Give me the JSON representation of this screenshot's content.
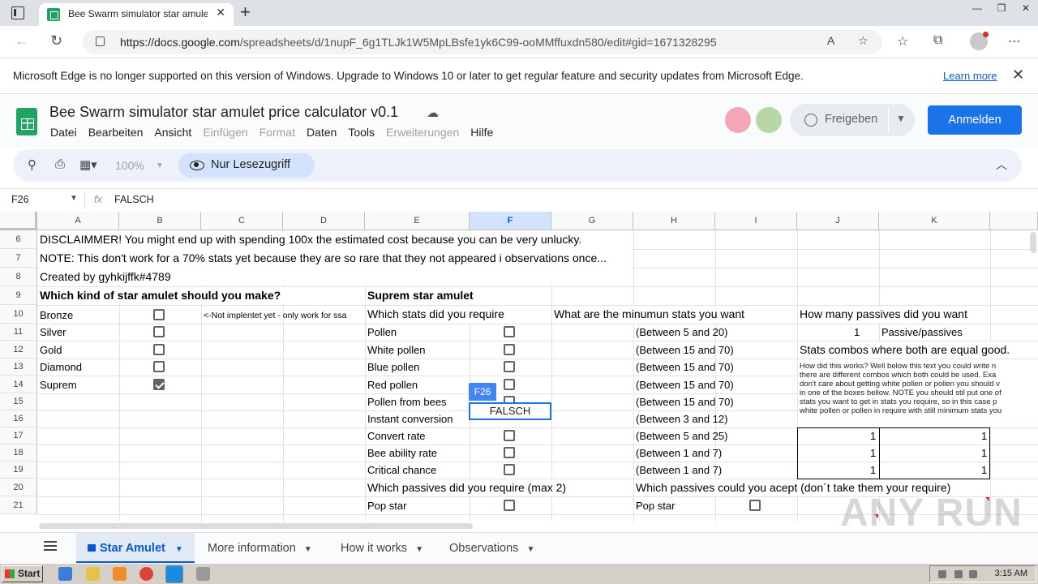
{
  "browser": {
    "tab_title": "Bee Swarm simulator star amulet",
    "url_domain": "https://docs.google.com",
    "url_path": "/spreadsheets/d/1nupF_6g1TLJk1W5MpLBsfe1yk6C99-ooMMffuxdn580/edit#gid=1671328295"
  },
  "infobar": {
    "message": "Microsoft Edge is no longer supported on this version of Windows. Upgrade to Windows 10 or later to get regular feature and security updates from Microsoft Edge.",
    "learn_more": "Learn more"
  },
  "doc": {
    "title": "Bee Swarm simulator star amulet price calculator v0.1",
    "menus": [
      {
        "label": "Datei",
        "enabled": true
      },
      {
        "label": "Bearbeiten",
        "enabled": true
      },
      {
        "label": "Ansicht",
        "enabled": true
      },
      {
        "label": "Einfügen",
        "enabled": false
      },
      {
        "label": "Format",
        "enabled": false
      },
      {
        "label": "Daten",
        "enabled": true
      },
      {
        "label": "Tools",
        "enabled": true
      },
      {
        "label": "Erweiterungen",
        "enabled": false
      },
      {
        "label": "Hilfe",
        "enabled": true
      }
    ],
    "share_label": "Freigeben",
    "signin_label": "Anmelden"
  },
  "toolbar": {
    "zoom": "100%",
    "readonly_label": "Nur Lesezugriff"
  },
  "formula_bar": {
    "name_box": "F26",
    "fx": "fx",
    "value": "FALSCH"
  },
  "columns": [
    "A",
    "B",
    "C",
    "D",
    "E",
    "F",
    "G",
    "H",
    "I",
    "J",
    "K"
  ],
  "selected_column": "F",
  "rows": [
    "6",
    "7",
    "8",
    "9",
    "10",
    "11",
    "12",
    "13",
    "14",
    "15",
    "16",
    "17",
    "18",
    "19",
    "20",
    "21"
  ],
  "cells": {
    "r6": "DISCLAIMMER! You might end up with spending 100x the estimated cost because you can be very unlucky.",
    "r7": "NOTE: This don't work for a 70% stats yet because they are so rare that they not appeared i observations once...",
    "r8": "Created by gyhkijffk#4789",
    "r9a": "Which kind of star amulet should you make?",
    "r9e": "Suprem star amulet",
    "r10a": "Bronze",
    "r10c": "<-Not implentet yet - only work for ssa",
    "r10e": "Which stats did you require",
    "r10g": "What are the minumun stats you want",
    "r10j": "How many passives did you want",
    "r11a": "Silver",
    "r11e": "Pollen",
    "r11h": "(Between 5 and 20)",
    "r11j": "1",
    "r11k": "Passive/passives",
    "r12a": "Gold",
    "r12e": "White pollen",
    "r12h": "(Between 15 and 70)",
    "r12j": "Stats combos where both are equal good.",
    "r13a": "Diamond",
    "r13e": "Blue pollen",
    "r13h": "(Between 15 and 70)",
    "r14a": "Suprem",
    "r14e": "Red pollen",
    "r14h": "(Between 15 and 70)",
    "r15e": "Pollen from bees",
    "r15h": "(Between 15 and 70)",
    "r16e": "Instant conversion",
    "r16h": "(Between 3 and 12)",
    "r17e": "Convert rate",
    "r17h": "(Between 5 and 25)",
    "r17j": "1",
    "r17k": "1",
    "r18e": "Bee ability rate",
    "r18h": "(Between 1 and 7)",
    "r18j": "1",
    "r18k": "1",
    "r19e": "Critical chance",
    "r19h": "(Between 1 and 7)",
    "r19j": "1",
    "r19k": "1",
    "r20e": "Which passives did you require (max 2)",
    "r20h": "Which passives could you acept (don´t take them your require)",
    "r21e": "Pop star",
    "r21h": "Pop star",
    "howto": [
      "How did this works? Well below this text you could write n",
      "there are different combos which both could be used. Exa",
      "don't care about getting white pollen or pollen you should v",
      "in one of the boxes bellow. NOTE you should stil put one of",
      "stats you want to get in stats you require, so in this case p",
      "white pollen or pollen in require with still minimum stats you"
    ]
  },
  "checkboxes": {
    "B10": false,
    "B11": false,
    "B12": false,
    "B13": false,
    "B14": true,
    "F11": false,
    "F12": false,
    "F13": false,
    "F14": false,
    "F15": false,
    "F17": false,
    "F18": false,
    "F19": false,
    "F21": false,
    "I21": false
  },
  "selected_cell": {
    "ref": "F26",
    "value": "FALSCH"
  },
  "sheet_tabs": [
    {
      "label": "Star Amulet",
      "active": true,
      "locked": true
    },
    {
      "label": "More information",
      "active": false
    },
    {
      "label": "How it works",
      "active": false
    },
    {
      "label": "Observations",
      "active": false
    }
  ],
  "taskbar": {
    "start": "Start",
    "clock": "3:15 AM"
  },
  "watermark": "ANY RUN"
}
